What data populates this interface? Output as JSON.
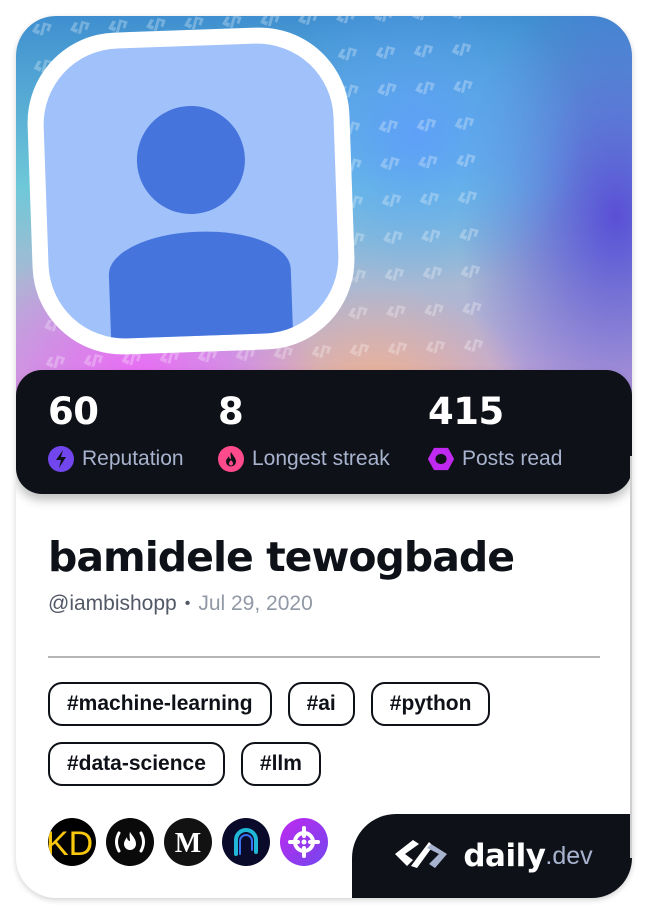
{
  "profile": {
    "name": "bamidele tewogbade",
    "username": "@iambishopp",
    "separator": "•",
    "joined": "Jul 29, 2020",
    "avatar": "default-user-avatar-icon"
  },
  "stats": [
    {
      "value": "60",
      "label": "Reputation",
      "icon": "lightning-icon",
      "color": "#7147ed"
    },
    {
      "value": "8",
      "label": "Longest streak",
      "icon": "flame-icon",
      "color": "#ff4b8c"
    },
    {
      "value": "415",
      "label": "Posts read",
      "icon": "ring-icon",
      "color": "#c029f0"
    }
  ],
  "tags": [
    "#machine-learning",
    "#ai",
    "#python",
    "#data-science",
    "#llm"
  ],
  "sources": [
    {
      "name": "KD",
      "icon": "kdnuggets-icon"
    },
    {
      "name": "freeCodeCamp",
      "icon": "freecodecamp-icon"
    },
    {
      "name": "Medium",
      "icon": "medium-icon",
      "glyph": "M"
    },
    {
      "name": "Source 4",
      "icon": "arch-logo-icon"
    },
    {
      "name": "Source 5",
      "icon": "crosshair-icon"
    }
  ],
  "brand": {
    "word": "daily",
    "tld": ".dev"
  },
  "colors": {
    "dark": "#0e1117",
    "muted": "#a8b3cf",
    "avatar_bg": "#a0c1fa",
    "avatar_fg": "#4574dd"
  }
}
